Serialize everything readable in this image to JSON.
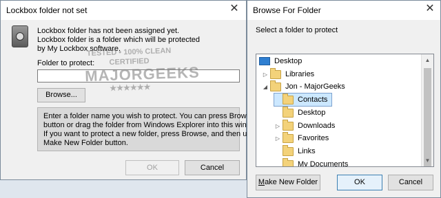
{
  "dialog1": {
    "title": "Lockbox folder not set",
    "message_line1": "Lockbox folder has not been assigned yet.",
    "message_line2": "Lockbox folder is a folder which will be protected",
    "message_line3": "by My Lockbox software.",
    "folder_label": "Folder to protect:",
    "folder_value": "",
    "browse_label": "Browse...",
    "help_line1": "Enter a folder name you wish to protect. You can press Browse",
    "help_line2": "button or drag the folder from Windows Explorer into this window.",
    "help_line3": "If you want to protect a new folder, press Browse, and then use",
    "help_line4": "Make New Folder button.",
    "ok_label": "OK",
    "cancel_label": "Cancel"
  },
  "watermark": {
    "line1": "TESTED • 100% CLEAN",
    "line2": "CERTIFIED",
    "line3": "MAJORGEEKS",
    "line4": "★★★★★★"
  },
  "dialog2": {
    "title": "Browse For Folder",
    "instruction": "Select a folder to protect",
    "tree": [
      "Desktop",
      "Libraries",
      "Jon - MajorGeeks",
      "Contacts",
      "Desktop",
      "Downloads",
      "Favorites",
      "Links",
      "My Documents"
    ],
    "make_new_folder_label_prefix": "M",
    "make_new_folder_label_rest": "ake New Folder",
    "ok_label": "OK",
    "cancel_label": "Cancel"
  },
  "colors": {
    "window_bg": "#f0f0f0",
    "selected_bg": "#cce8ff",
    "folder_yellow": "#f3d27a"
  }
}
